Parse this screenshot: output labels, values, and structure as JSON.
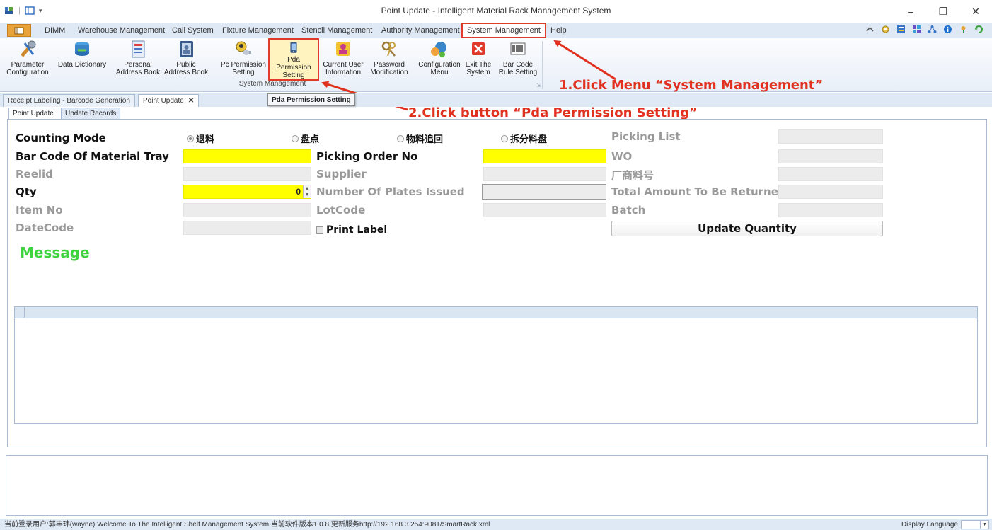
{
  "window": {
    "title": "Point Update - Intelligent Material Rack Management System"
  },
  "menu": {
    "items": [
      "DIMM",
      "Warehouse Management",
      "Call System",
      "Fixture Management",
      "Stencil Management",
      "Authority Management",
      "System Management",
      "Help"
    ],
    "active": "System Management"
  },
  "ribbon": {
    "buttons": [
      {
        "l1": "Parameter",
        "l2": "Configuration"
      },
      {
        "l1": "Data Dictionary",
        "l2": ""
      },
      {
        "l1": "Personal",
        "l2": "Address Book"
      },
      {
        "l1": "Public",
        "l2": "Address Book"
      },
      {
        "l1": "Pc Permission",
        "l2": "Setting"
      },
      {
        "l1": "Pda Permission",
        "l2": "Setting"
      },
      {
        "l1": "Current User",
        "l2": "Information"
      },
      {
        "l1": "Password",
        "l2": "Modification"
      },
      {
        "l1": "Configuration",
        "l2": "Menu"
      },
      {
        "l1": "Exit The",
        "l2": "System"
      },
      {
        "l1": "Bar Code",
        "l2": "Rule Setting"
      }
    ],
    "group_label": "System Management"
  },
  "tooltip": "Pda Permission Setting",
  "annotations": {
    "step1": "1.Click Menu  “System Management”",
    "step2": "2.Click  button  “Pda Permission Setting”"
  },
  "doc_tabs": [
    "Receipt Labeling - Barcode Generation",
    "Point Update"
  ],
  "sub_tabs": [
    "Point Update",
    "Update Records"
  ],
  "form": {
    "counting_mode": "Counting Mode",
    "modes": [
      "退料",
      "盘点",
      "物料追回",
      "拆分料盘"
    ],
    "bar_code": "Bar Code Of Material Tray",
    "reelid": "Reelid",
    "qty": "Qty",
    "qty_value": "0",
    "item_no": "Item No",
    "datecode": "DateCode",
    "picking_order": "Picking Order No",
    "supplier": "Supplier",
    "plates_issued": "Number Of Plates Issued",
    "lotcode": "LotCode",
    "print_label": "Print Label",
    "picking_list": "Picking List",
    "wo": "WO",
    "vendor_part": "厂商料号",
    "total_returned": "Total Amount To Be Returned",
    "batch": "Batch",
    "update_button": "Update Quantity",
    "message": "Message"
  },
  "status": {
    "text": "当前登录用户:郭丰玮(wayne)  Welcome To The Intelligent Shelf Management System  当前软件版本1.0.8,更新服务http://192.168.3.254:9081/SmartRack.xml",
    "lang_label": "Display Language"
  }
}
